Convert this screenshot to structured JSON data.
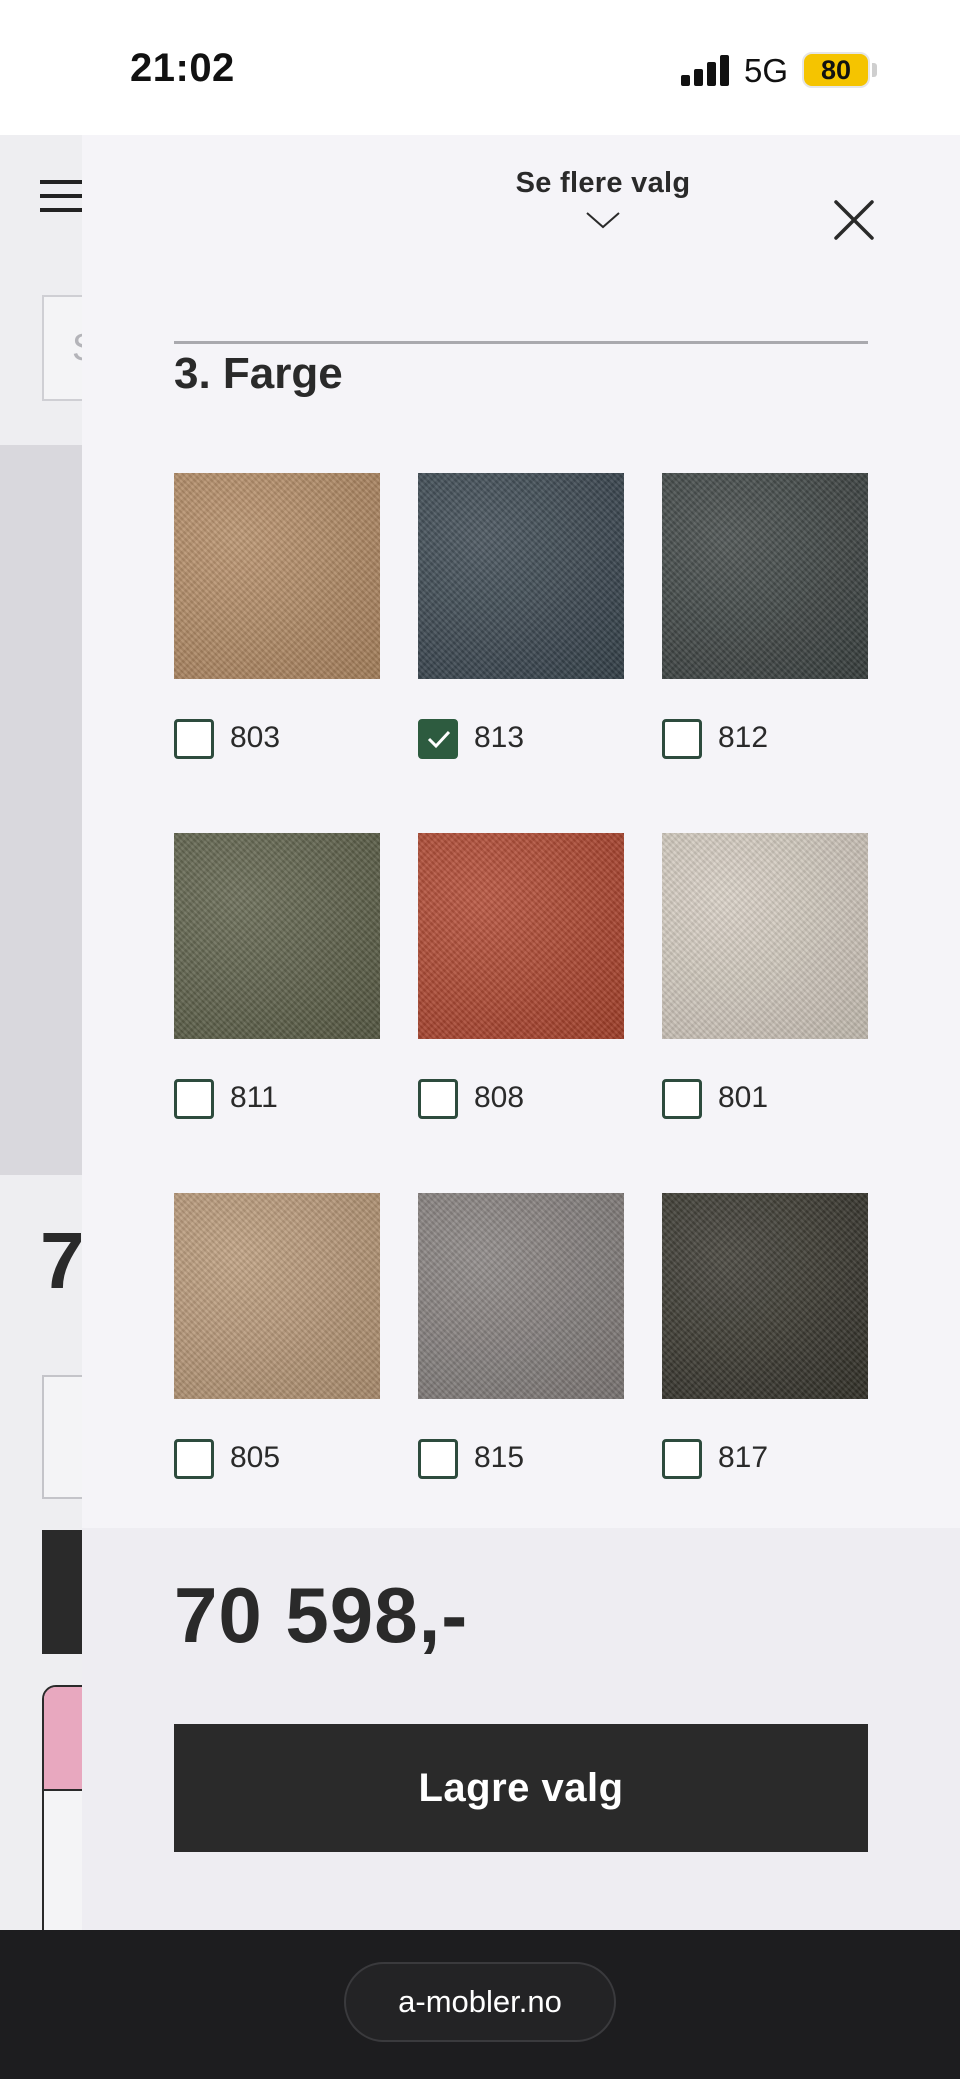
{
  "status_bar": {
    "time": "21:02",
    "network": "5G",
    "battery": "80",
    "battery_color": "#f5c400"
  },
  "background_page": {
    "menu_icon": "hamburger-icon",
    "search_placeholder_initial": "S",
    "price_fragment": "7"
  },
  "drawer": {
    "more_options_label": "Se flere valg",
    "more_options_icon": "chevron-down-icon",
    "close_icon": "close-icon",
    "section_title": "3. Farge",
    "swatches": [
      {
        "code": "803",
        "checked": false,
        "color": "#b68c64"
      },
      {
        "code": "813",
        "checked": true,
        "color": "#38454f"
      },
      {
        "code": "812",
        "checked": false,
        "color": "#3c4342"
      },
      {
        "code": "811",
        "checked": false,
        "color": "#5d6048"
      },
      {
        "code": "808",
        "checked": false,
        "color": "#b2442c"
      },
      {
        "code": "801",
        "checked": false,
        "color": "#d8cfc3"
      },
      {
        "code": "805",
        "checked": false,
        "color": "#bc9a78"
      },
      {
        "code": "815",
        "checked": false,
        "color": "#86807e"
      },
      {
        "code": "817",
        "checked": false,
        "color": "#36342b"
      }
    ],
    "price": "70 598,-",
    "save_label": "Lagre valg"
  },
  "browser": {
    "url": "a-mobler.no"
  },
  "colors": {
    "accent_checkbox": "#2d5b3f",
    "button_dark": "#2a2a2a",
    "drawer_bg": "#f5f4f8"
  }
}
